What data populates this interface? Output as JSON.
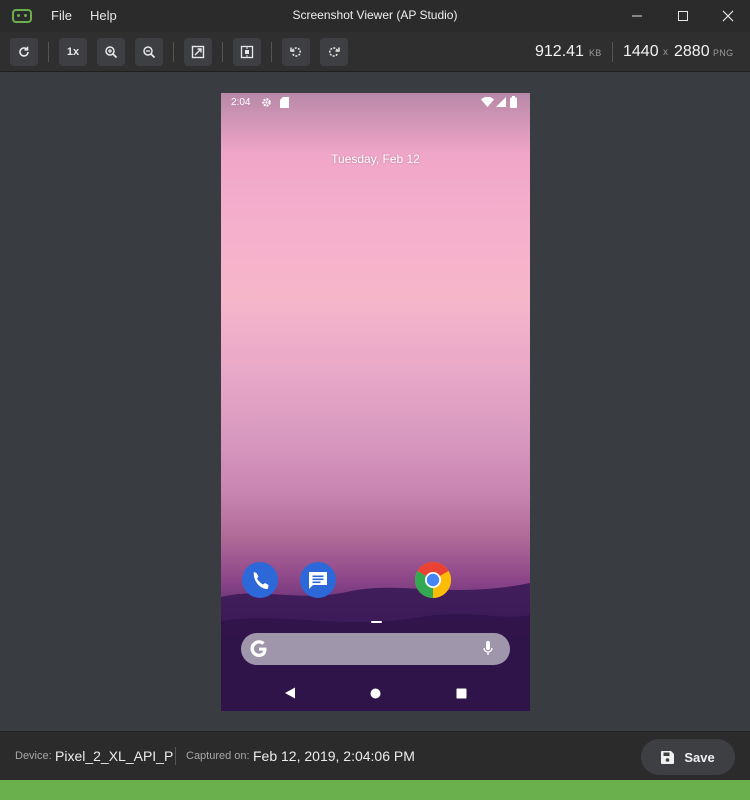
{
  "window": {
    "title": "Screenshot Viewer (AP Studio)",
    "menus": [
      "File",
      "Help"
    ]
  },
  "toolbar": {
    "buttons": [
      "refresh-icon",
      "1x",
      "zoom-in-icon",
      "zoom-out-icon",
      "fit-to-window-icon",
      "frame-icon",
      "rotate-left-icon",
      "rotate-right-icon"
    ],
    "zoom_label": "1x",
    "file_size": "912.41",
    "file_size_unit": "KB",
    "width": "1440",
    "times": "x",
    "height": "2880",
    "format": "PNG"
  },
  "phone": {
    "time": "2:04",
    "date": "Tuesday, Feb 12",
    "apps": [
      "phone-icon",
      "messages-icon",
      "chrome-icon"
    ]
  },
  "footer": {
    "device_label": "Device:",
    "device_value": "Pixel_2_XL_API_P",
    "captured_label": "Captured on:",
    "captured_value": "Feb 12, 2019, 2:04:06 PM",
    "save_label": "Save"
  },
  "colors": {
    "accent_green": "#6ab04c",
    "titlebar": "#2b2b2b",
    "canvas": "#393c40"
  }
}
